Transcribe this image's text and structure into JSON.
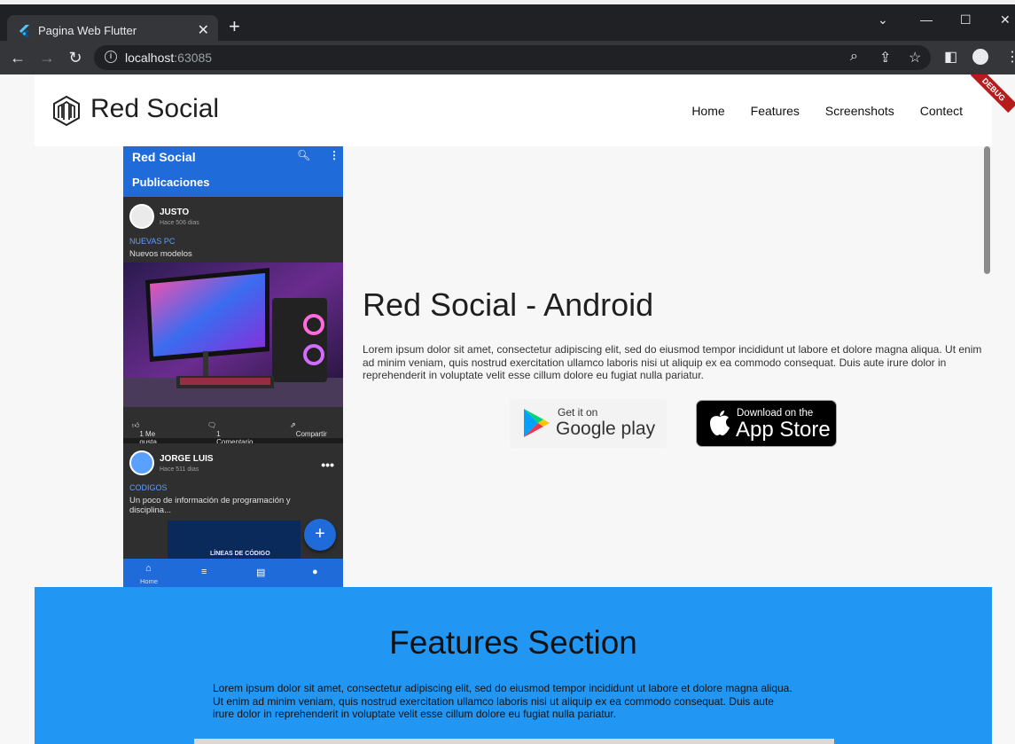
{
  "browser": {
    "tab_title": "Pagina Web Flutter",
    "url_host": "localhost",
    "url_port": ":63085"
  },
  "navbar": {
    "brand": "Red Social",
    "links": [
      "Home",
      "Features",
      "Screenshots",
      "Contect"
    ]
  },
  "debug_banner": "DEBUG",
  "phone": {
    "app_title": "Red Social",
    "app_subtitle": "Publicaciones",
    "posts": [
      {
        "user": "JUSTO",
        "date": "Hace 506 dias",
        "title": "NUEVAS PC",
        "text": "Nuevos modelos",
        "likes": "1 Me gusta",
        "comments": "1 Comentario",
        "share": "Compartir"
      },
      {
        "user": "JORGE LUIS",
        "date": "Hace 511 dias",
        "title": "CODIGOS",
        "text": "Un poco de información de programación y disciplina...",
        "image_caption": "LÍNEAS DE CÓDIGO"
      }
    ],
    "bottom_nav_label": "Home"
  },
  "hero": {
    "title": "Red Social - Android",
    "text": "Lorem ipsum dolor sit amet, consectetur adipiscing elit, sed do eiusmod tempor incididunt ut labore et dolore magna aliqua. Ut enim ad minim veniam, quis nostrud exercitation ullamco laboris nisi ut aliquip ex ea commodo consequat. Duis aute irure dolor in reprehenderit in voluptate velit esse cillum dolore eu fugiat nulla pariatur.",
    "google_small": "Get it on",
    "google_big": "Google play",
    "apple_small": "Download on the",
    "apple_big": "App Store"
  },
  "features": {
    "title": "Features Section",
    "text": "Lorem ipsum dolor sit amet, consectetur adipiscing elit, sed do eiusmod tempor incididunt ut labore et dolore magna aliqua. Ut enim ad minim veniam, quis nostrud exercitation ullamco laboris nisi ut aliquip ex ea commodo consequat. Duis aute irure dolor in reprehenderit in voluptate velit esse cillum dolore eu fugiat nulla pariatur."
  },
  "colors": {
    "primary_blue": "#1e6bd9",
    "features_bg": "#2196f3",
    "chrome_dark": "#202124"
  }
}
